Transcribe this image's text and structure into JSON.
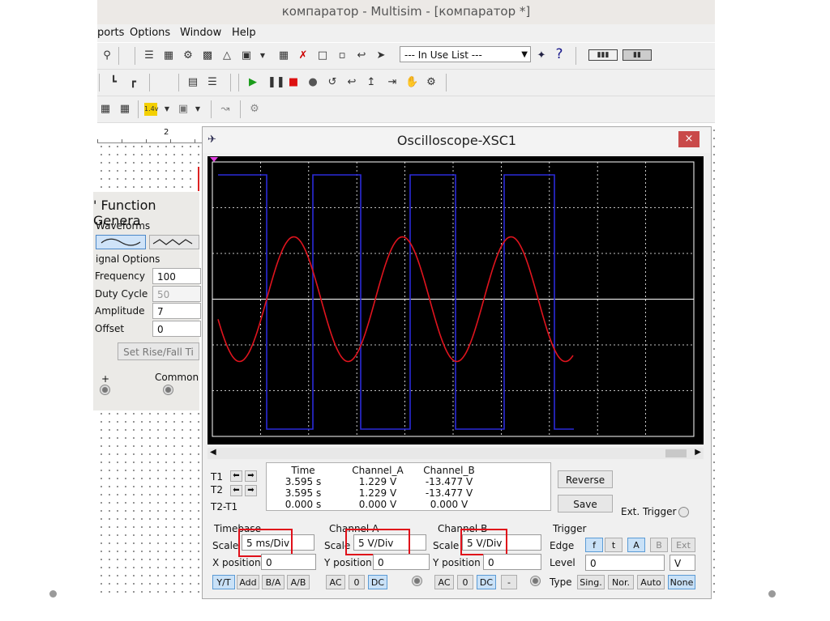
{
  "window": {
    "title": "компаратор - Multisim - [компаратор *]"
  },
  "menu": {
    "items": [
      "ports",
      "Options",
      "Window",
      "Help"
    ]
  },
  "toolbar": {
    "in_use_list": "--- In Use List ---"
  },
  "ruler": {
    "mark": "2"
  },
  "function_generator": {
    "title": "' Function Genera",
    "waveforms_label": "Waveforms",
    "signal_options_label": "ignal Options",
    "fields": [
      {
        "label": "Frequency",
        "value": "100"
      },
      {
        "label": "Duty Cycle",
        "value": "50"
      },
      {
        "label": "Amplitude",
        "value": "7"
      },
      {
        "label": "Offset",
        "value": "0"
      }
    ],
    "set_rise_fall": "Set Rise/Fall Ti",
    "plus_label": "+",
    "common_label": "Common"
  },
  "oscilloscope": {
    "title": "Oscilloscope-XSC1",
    "close_label": "×",
    "colors": {
      "channel_a": "#e0141e",
      "channel_b": "#2b2bd9",
      "grid": "#ffffff"
    },
    "readout": {
      "t1_label": "T1",
      "t2_label": "T2",
      "t2t1_label": "T2-T1",
      "headers": [
        "Time",
        "Channel_A",
        "Channel_B"
      ],
      "rows": [
        [
          "3.595 s",
          "1.229 V",
          "-13.477 V"
        ],
        [
          "3.595 s",
          "1.229 V",
          "-13.477 V"
        ],
        [
          "0.000 s",
          "0.000 V",
          "0.000 V"
        ]
      ]
    },
    "reverse_label": "Reverse",
    "save_label": "Save",
    "ext_trigger_label": "Ext. Trigger",
    "timebase": {
      "title": "Timebase",
      "scale_label": "Scale",
      "scale": "5 ms/Div",
      "xpos_label": "X position",
      "xpos": "0",
      "buttons": [
        "Y/T",
        "Add",
        "B/A",
        "A/B"
      ]
    },
    "channel_a": {
      "title": "Channel A",
      "scale_label": "Scale",
      "scale": "5  V/Div",
      "ypos_label": "Y position",
      "ypos": "0",
      "buttons": [
        "AC",
        "0",
        "DC"
      ]
    },
    "channel_b": {
      "title": "Channel B",
      "scale_label": "Scale",
      "scale": "5  V/Div",
      "ypos_label": "Y position",
      "ypos": "0",
      "buttons": [
        "AC",
        "0",
        "DC",
        "-"
      ]
    },
    "trigger": {
      "title": "Trigger",
      "edge_label": "Edge",
      "edge_buttons": [
        "f",
        "t",
        "A",
        "B",
        "Ext"
      ],
      "level_label": "Level",
      "level": "0",
      "level_unit": "V",
      "type_label": "Type",
      "type_buttons": [
        "Sing.",
        "Nor.",
        "Auto",
        "None"
      ]
    }
  }
}
